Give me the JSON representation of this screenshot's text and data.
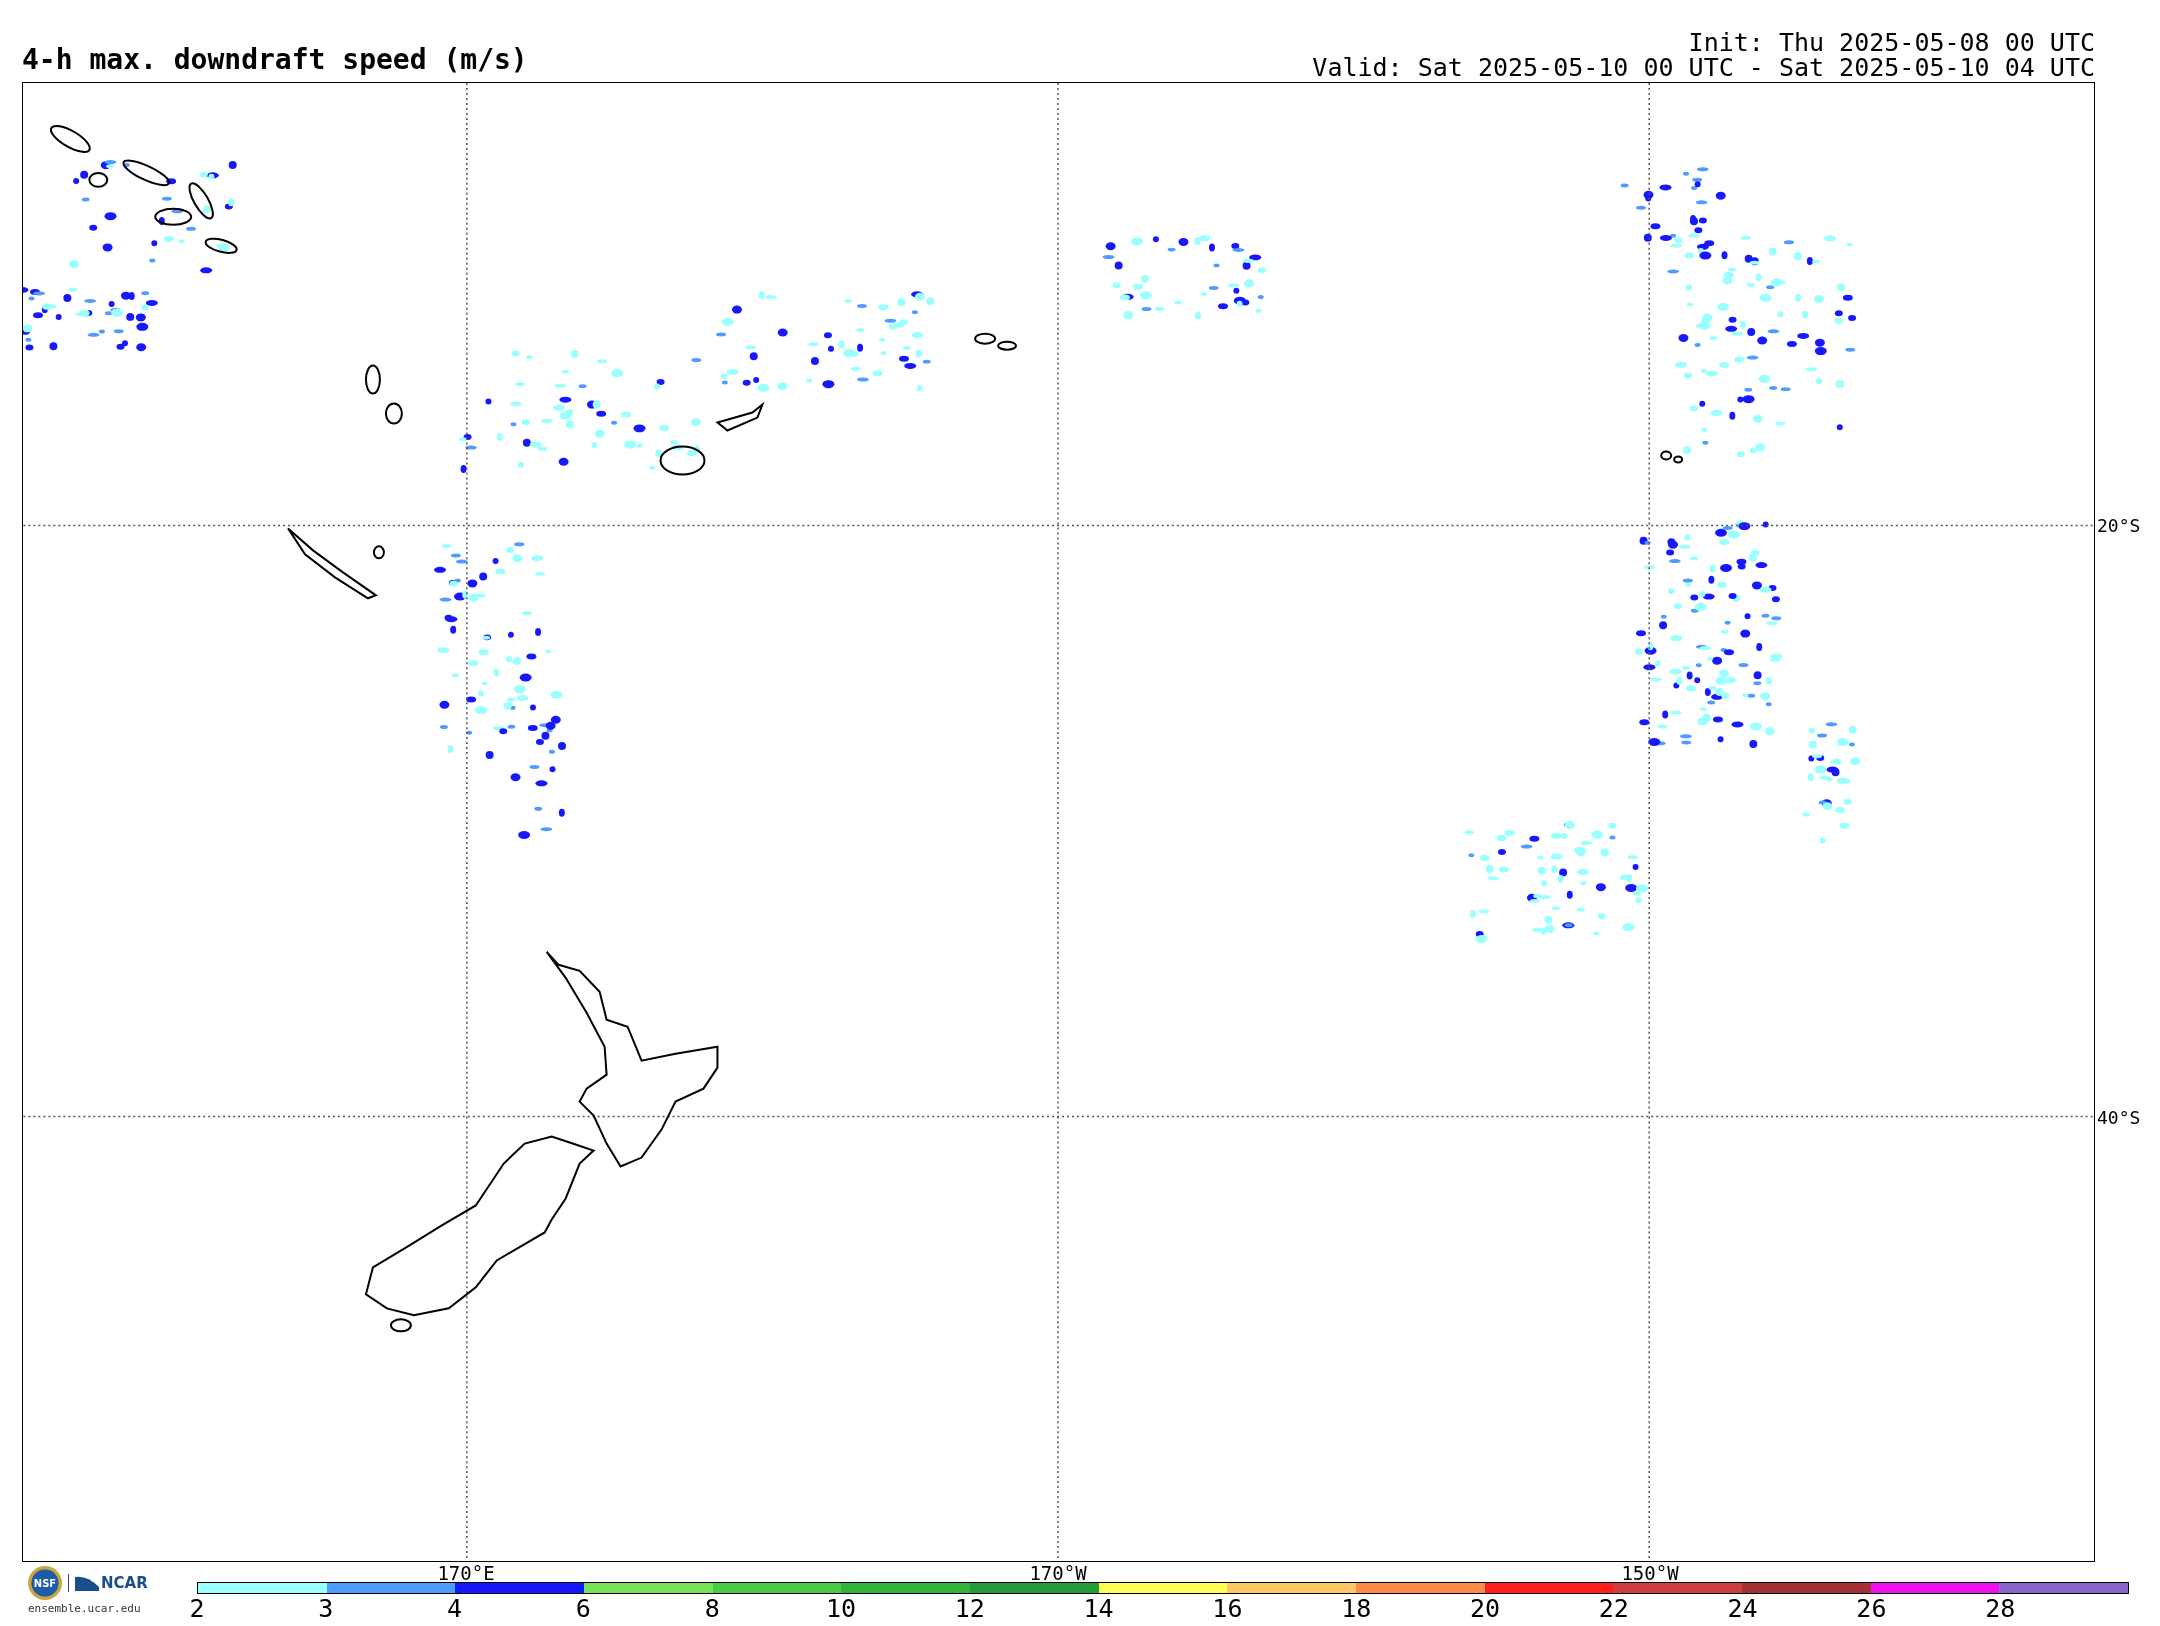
{
  "title": "4-h max. downdraft speed (m/s)",
  "init": "Init: Thu 2025-05-08 00 UTC",
  "valid": "Valid: Sat 2025-05-10 00 UTC - Sat 2025-05-10 04 UTC",
  "map": {
    "lat_labels": [
      "20°S",
      "40°S"
    ],
    "lon_labels": [
      "170°E",
      "170°W",
      "150°W"
    ]
  },
  "logos": {
    "nsf": "NSF",
    "ncar": "NCAR",
    "url": "ensemble.ucar.edu"
  },
  "colorbar": {
    "segments": [
      {
        "color": "#99ffff",
        "label": "2"
      },
      {
        "color": "#4f9bff",
        "label": "3"
      },
      {
        "color": "#1818ff",
        "label": "4"
      },
      {
        "color": "#7be35a",
        "label": "6"
      },
      {
        "color": "#4ccb48",
        "label": "8"
      },
      {
        "color": "#33b33b",
        "label": "10"
      },
      {
        "color": "#279b3a",
        "label": "12"
      },
      {
        "color": "#ffff55",
        "label": "14"
      },
      {
        "color": "#ffc866",
        "label": "16"
      },
      {
        "color": "#ff8a4a",
        "label": "18"
      },
      {
        "color": "#ff1f1f",
        "label": "20"
      },
      {
        "color": "#cc3f3f",
        "label": "22"
      },
      {
        "color": "#a53232",
        "label": "24"
      },
      {
        "color": "#ee11ee",
        "label": "26"
      },
      {
        "color": "#8866cc",
        "label": "28"
      }
    ]
  }
}
